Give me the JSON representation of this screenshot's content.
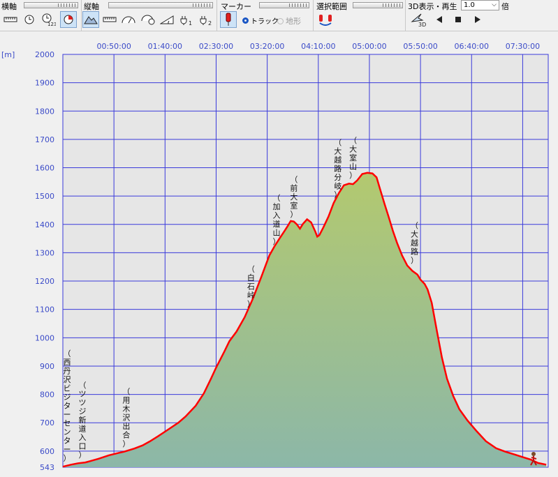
{
  "toolbar": {
    "horizontal_axis": "横軸",
    "vertical_axis": "縦軸",
    "marker": "マーカー",
    "selection": "選択範囲",
    "playback": "3D表示・再生",
    "speed_value": "1.0",
    "speed_unit": "倍",
    "radio_track": "トラック",
    "radio_terrain": "地形",
    "sub_123": "123",
    "sub_1": "1",
    "sub_2": "2",
    "sub_3d": "3D"
  },
  "colors": {
    "line": "#ff0000",
    "fill_top": "#b3c96f",
    "fill_bottom": "#8cb7a8",
    "plot_bg": "#e6e6e6",
    "grid": "#3a3adb",
    "axis_text": "#3b4bc8"
  },
  "chart_data": {
    "type": "area",
    "x_unit": "elapsed time",
    "y_unit": "[m]",
    "xlim_minutes": [
      0,
      475
    ],
    "ylim": [
      543,
      2000
    ],
    "x_ticks": [
      "00:50:00",
      "01:40:00",
      "02:30:00",
      "03:20:00",
      "04:10:00",
      "05:00:00",
      "05:50:00",
      "06:40:00",
      "07:30:00"
    ],
    "x_tick_minutes": [
      50,
      100,
      150,
      200,
      250,
      300,
      350,
      400,
      450
    ],
    "y_ticks": [
      543,
      600,
      700,
      800,
      900,
      1000,
      1100,
      1200,
      1300,
      1400,
      1500,
      1600,
      1700,
      1800,
      1900,
      2000
    ],
    "grid": true,
    "series": [
      {
        "points": [
          [
            0,
            545
          ],
          [
            8,
            552
          ],
          [
            15,
            557
          ],
          [
            22,
            560
          ],
          [
            28,
            566
          ],
          [
            35,
            573
          ],
          [
            45,
            585
          ],
          [
            55,
            594
          ],
          [
            60,
            598
          ],
          [
            70,
            609
          ],
          [
            78,
            620
          ],
          [
            85,
            634
          ],
          [
            93,
            652
          ],
          [
            103,
            676
          ],
          [
            113,
            700
          ],
          [
            120,
            722
          ],
          [
            130,
            760
          ],
          [
            138,
            804
          ],
          [
            145,
            856
          ],
          [
            150,
            895
          ],
          [
            158,
            951
          ],
          [
            163,
            988
          ],
          [
            170,
            1022
          ],
          [
            178,
            1073
          ],
          [
            186,
            1138
          ],
          [
            194,
            1213
          ],
          [
            202,
            1290
          ],
          [
            207,
            1322
          ],
          [
            212,
            1350
          ],
          [
            217,
            1377
          ],
          [
            220,
            1394
          ],
          [
            223,
            1412
          ],
          [
            226,
            1410
          ],
          [
            229,
            1400
          ],
          [
            232,
            1385
          ],
          [
            235,
            1402
          ],
          [
            239,
            1418
          ],
          [
            243,
            1407
          ],
          [
            247,
            1375
          ],
          [
            249,
            1357
          ],
          [
            251,
            1362
          ],
          [
            255,
            1390
          ],
          [
            260,
            1428
          ],
          [
            265,
            1475
          ],
          [
            270,
            1510
          ],
          [
            275,
            1538
          ],
          [
            280,
            1544
          ],
          [
            284,
            1542
          ],
          [
            288,
            1555
          ],
          [
            293,
            1578
          ],
          [
            298,
            1582
          ],
          [
            303,
            1580
          ],
          [
            307,
            1566
          ],
          [
            311,
            1518
          ],
          [
            315,
            1470
          ],
          [
            319,
            1425
          ],
          [
            323,
            1377
          ],
          [
            327,
            1335
          ],
          [
            332,
            1290
          ],
          [
            337,
            1255
          ],
          [
            342,
            1236
          ],
          [
            347,
            1223
          ],
          [
            350,
            1205
          ],
          [
            354,
            1190
          ],
          [
            357,
            1170
          ],
          [
            361,
            1123
          ],
          [
            366,
            1025
          ],
          [
            371,
            930
          ],
          [
            376,
            855
          ],
          [
            382,
            795
          ],
          [
            388,
            748
          ],
          [
            396,
            708
          ],
          [
            405,
            670
          ],
          [
            414,
            635
          ],
          [
            424,
            610
          ],
          [
            433,
            598
          ],
          [
            442,
            588
          ],
          [
            450,
            579
          ],
          [
            458,
            570
          ],
          [
            465,
            558
          ],
          [
            473,
            552
          ]
        ]
      }
    ],
    "annotations": [
      {
        "text": "西丹沢ビジターセンター",
        "min": 0
      },
      {
        "text": "ツツジ新道入口",
        "min": 15
      },
      {
        "text": "用木沢出合",
        "min": 58
      },
      {
        "text": "白石峠",
        "min": 180
      },
      {
        "text": "加入道山",
        "min": 205
      },
      {
        "text": "前大室",
        "min": 222
      },
      {
        "text": "大越路分岐",
        "min": 265
      },
      {
        "text": "大室山",
        "min": 280
      },
      {
        "text": "大越路",
        "min": 340
      }
    ]
  }
}
